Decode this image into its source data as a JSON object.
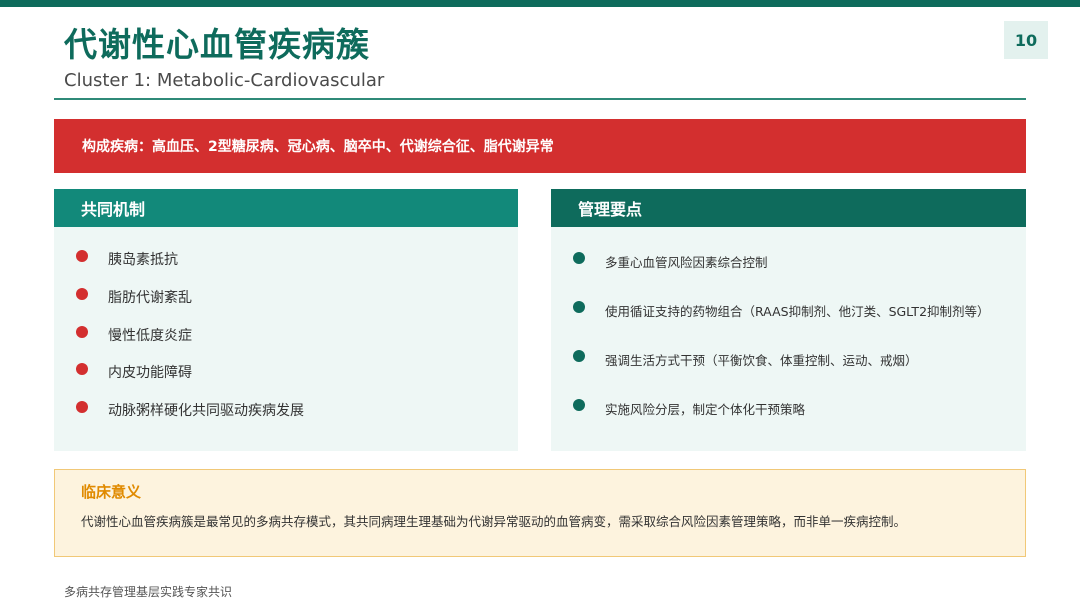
{
  "header": {
    "title": "代谢性心血管疾病簇",
    "subtitle": "Cluster 1: Metabolic-Cardiovascular",
    "page_number": "10"
  },
  "banner": {
    "text": "构成疾病：高血压、2型糖尿病、冠心病、脑卒中、代谢综合征、脂代谢异常"
  },
  "mechanisms": {
    "title": "共同机制",
    "items": [
      "胰岛素抵抗",
      "脂肪代谢紊乱",
      "慢性低度炎症",
      "内皮功能障碍",
      "动脉粥样硬化共同驱动疾病发展"
    ]
  },
  "management": {
    "title": "管理要点",
    "items": [
      "多重心血管风险因素综合控制",
      "使用循证支持的药物组合（RAAS抑制剂、他汀类、SGLT2抑制剂等）",
      "强调生活方式干预（平衡饮食、体重控制、运动、戒烟）",
      "实施风险分层，制定个体化干预策略"
    ]
  },
  "clinical": {
    "title": "临床意义",
    "text": "代谢性心血管疾病簇是最常见的多病共存模式，其共同病理生理基础为代谢异常驱动的血管病变，需采取综合风险因素管理策略，而非单一疾病控制。"
  },
  "footer": {
    "text": "多病共存管理基层实践专家共识"
  },
  "colors": {
    "primary": "#0e6b5c",
    "accent_red": "#d32f2f",
    "card_bg": "#eef7f5",
    "note_bg": "#fdf3de",
    "note_border": "#f1c877",
    "note_title": "#e08a00"
  }
}
